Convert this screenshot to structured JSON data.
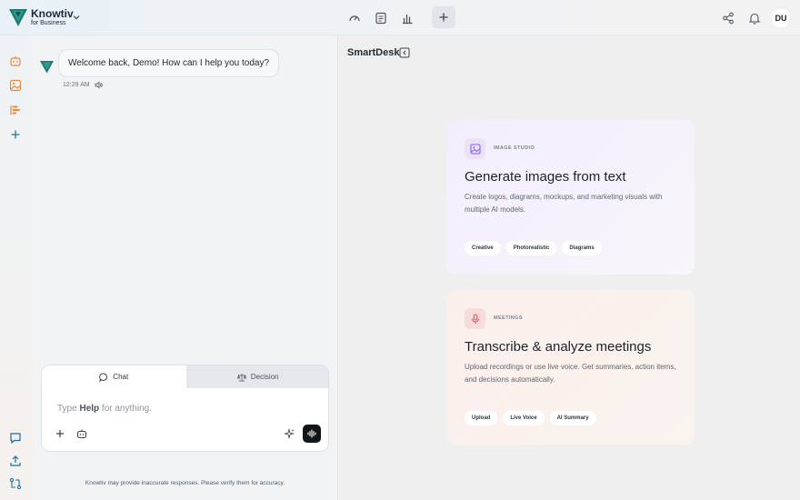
{
  "brand": {
    "name": "Knowtiv",
    "subtitle": "for Business"
  },
  "user": {
    "initials": "DU"
  },
  "chat": {
    "welcome_message": "Welcome back, Demo! How can I help you today?",
    "timestamp": "12:29 AM",
    "modes": [
      "Chat",
      "Decision"
    ],
    "prompt": {
      "prefix": "Type",
      "keyword": "Help",
      "suffix": "for anything."
    },
    "disclaimer": "Knowtiv may provide inaccurate responses. Please verify them for accuracy."
  },
  "smartdesk": {
    "title": "SmartDesk",
    "cards": [
      {
        "kicker": "IMAGE STUDIO",
        "title": "Generate images from text",
        "description": "Create logos, diagrams, mockups, and marketing visuals with multiple AI models.",
        "tags": [
          "Creative",
          "Photorealistic",
          "Diagrams"
        ]
      },
      {
        "kicker": "MEETINGS",
        "title": "Transcribe & analyze meetings",
        "description": "Upload recordings or use live voice. Get summaries, action items, and decisions automatically.",
        "tags": [
          "Upload",
          "Live Voice",
          "AI Summary"
        ]
      }
    ]
  },
  "colors": {
    "brand_teal": "#1f7a74",
    "accent_orange": "#e8893b",
    "image_card_icon": "#8b5cf6",
    "meeting_card_icon": "#e0585f"
  },
  "icons": {
    "top": [
      "gauge-icon",
      "document-list-icon",
      "bar-chart-icon",
      "plus-icon",
      "share-icon",
      "bell-icon"
    ],
    "rail": [
      "robot-icon",
      "image-icon",
      "timeline-icon",
      "plus-icon",
      "chat-bubble-icon",
      "upload-icon",
      "workflow-icon"
    ]
  }
}
